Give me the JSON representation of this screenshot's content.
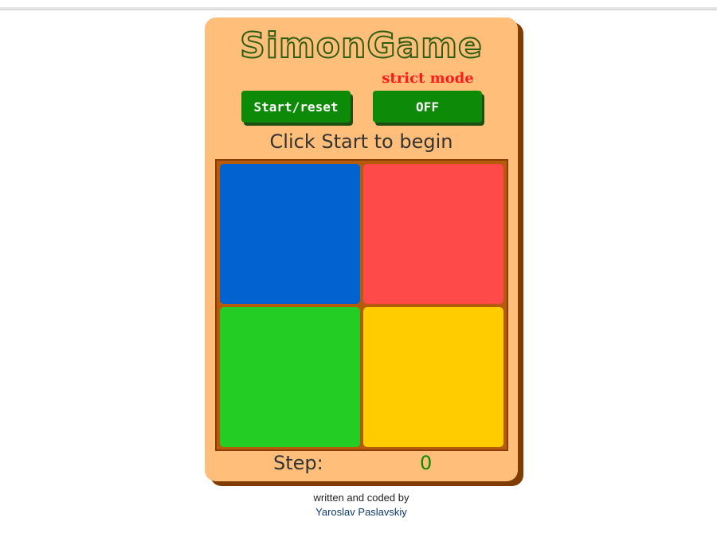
{
  "app": {
    "title": "SimonGame"
  },
  "controls": {
    "strict_label": "strict mode",
    "start_reset_label": "Start/reset",
    "strict_toggle_value": "OFF"
  },
  "status": {
    "message": "Click Start to begin"
  },
  "board": {
    "pads": [
      {
        "name": "blue",
        "color": "#0263d0"
      },
      {
        "name": "red",
        "color": "#ff4a4a"
      },
      {
        "name": "green",
        "color": "#24cd24"
      },
      {
        "name": "yellow",
        "color": "#ffcc00"
      }
    ]
  },
  "step": {
    "label": "Step:",
    "value": "0"
  },
  "footer": {
    "credit": "written and coded by",
    "author": "Yaroslav Paslavskiy"
  },
  "colors": {
    "card": "#ffbf7a",
    "button": "#0d8a07",
    "title_stroke": "#2e5d12",
    "strict_label": "#ff1a1a"
  }
}
